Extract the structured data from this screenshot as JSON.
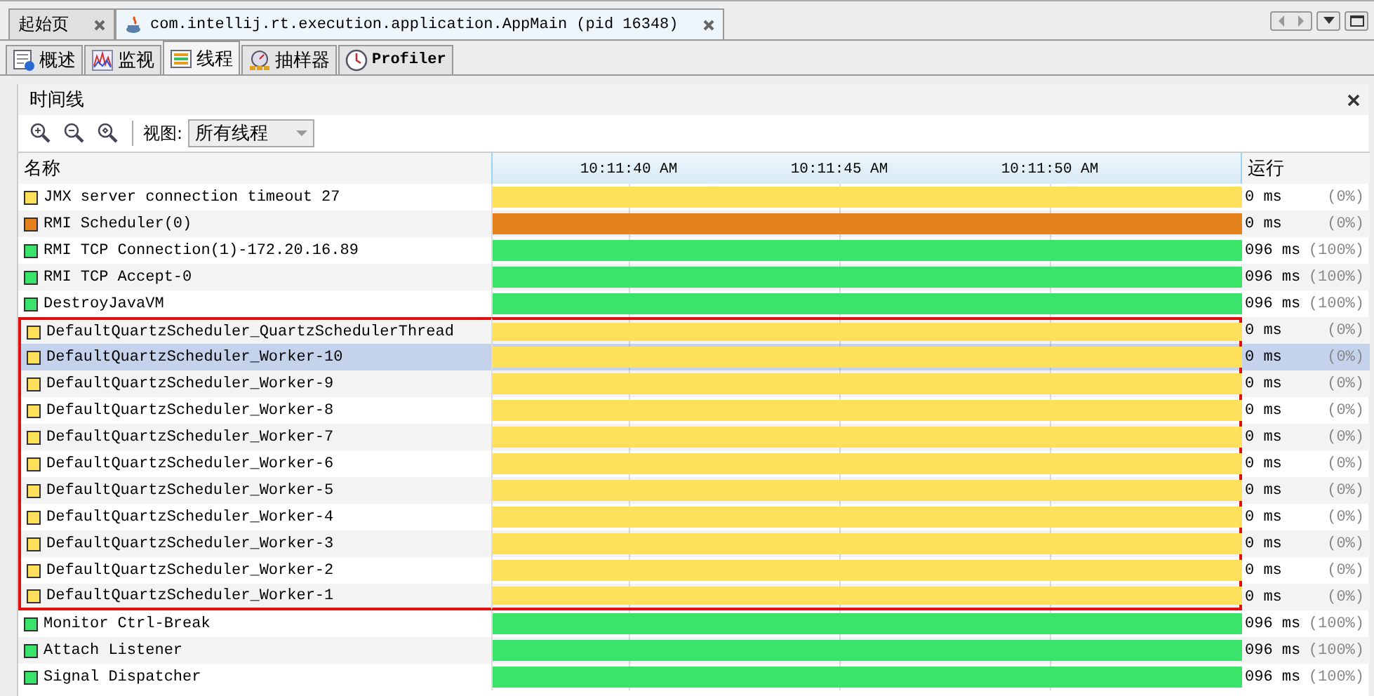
{
  "editor_tabs": [
    {
      "label": "起始页",
      "selected": false,
      "closable": true,
      "kind": "start"
    },
    {
      "label": "com.intellij.rt.execution.application.AppMain (pid 16348)",
      "selected": true,
      "closable": true,
      "kind": "java"
    }
  ],
  "view_tabs": [
    {
      "label": "概述",
      "selected": false,
      "kind": "overview"
    },
    {
      "label": "监视",
      "selected": false,
      "kind": "monitor"
    },
    {
      "label": "线程",
      "selected": true,
      "kind": "threads"
    },
    {
      "label": "抽样器",
      "selected": false,
      "kind": "sampler"
    },
    {
      "label": "Profiler",
      "selected": false,
      "kind": "profiler"
    }
  ],
  "panel": {
    "title": "时间线",
    "view_label": "视图:",
    "view_value": "所有线程"
  },
  "table": {
    "columns": [
      "名称",
      "运行"
    ],
    "time_ticks": [
      "10:11:40 AM",
      "10:11:45 AM",
      "10:11:50 AM"
    ],
    "rows": [
      {
        "name": "JMX server connection timeout 27",
        "color": "#ffe05a",
        "run": "0 ms",
        "percent": "(0%)",
        "selected": false,
        "highlighted": false
      },
      {
        "name": "RMI Scheduler(0)",
        "color": "#e6821e",
        "run": "0 ms",
        "percent": "(0%)",
        "selected": false,
        "highlighted": false
      },
      {
        "name": "RMI TCP Connection(1)-172.20.16.89",
        "color": "#3ae46a",
        "run": "096 ms",
        "percent": "(100%)",
        "selected": false,
        "highlighted": false
      },
      {
        "name": "RMI TCP Accept-0",
        "color": "#3ae46a",
        "run": "096 ms",
        "percent": "(100%)",
        "selected": false,
        "highlighted": false
      },
      {
        "name": "DestroyJavaVM",
        "color": "#3ae46a",
        "run": "096 ms",
        "percent": "(100%)",
        "selected": false,
        "highlighted": false
      },
      {
        "name": "DefaultQuartzScheduler_QuartzSchedulerThread",
        "color": "#ffe05a",
        "run": "0 ms",
        "percent": "(0%)",
        "selected": false,
        "highlighted": true
      },
      {
        "name": "DefaultQuartzScheduler_Worker-10",
        "color": "#ffe05a",
        "run": "0 ms",
        "percent": "(0%)",
        "selected": true,
        "highlighted": true
      },
      {
        "name": "DefaultQuartzScheduler_Worker-9",
        "color": "#ffe05a",
        "run": "0 ms",
        "percent": "(0%)",
        "selected": false,
        "highlighted": true
      },
      {
        "name": "DefaultQuartzScheduler_Worker-8",
        "color": "#ffe05a",
        "run": "0 ms",
        "percent": "(0%)",
        "selected": false,
        "highlighted": true
      },
      {
        "name": "DefaultQuartzScheduler_Worker-7",
        "color": "#ffe05a",
        "run": "0 ms",
        "percent": "(0%)",
        "selected": false,
        "highlighted": true
      },
      {
        "name": "DefaultQuartzScheduler_Worker-6",
        "color": "#ffe05a",
        "run": "0 ms",
        "percent": "(0%)",
        "selected": false,
        "highlighted": true
      },
      {
        "name": "DefaultQuartzScheduler_Worker-5",
        "color": "#ffe05a",
        "run": "0 ms",
        "percent": "(0%)",
        "selected": false,
        "highlighted": true
      },
      {
        "name": "DefaultQuartzScheduler_Worker-4",
        "color": "#ffe05a",
        "run": "0 ms",
        "percent": "(0%)",
        "selected": false,
        "highlighted": true
      },
      {
        "name": "DefaultQuartzScheduler_Worker-3",
        "color": "#ffe05a",
        "run": "0 ms",
        "percent": "(0%)",
        "selected": false,
        "highlighted": true
      },
      {
        "name": "DefaultQuartzScheduler_Worker-2",
        "color": "#ffe05a",
        "run": "0 ms",
        "percent": "(0%)",
        "selected": false,
        "highlighted": true
      },
      {
        "name": "DefaultQuartzScheduler_Worker-1",
        "color": "#ffe05a",
        "run": "0 ms",
        "percent": "(0%)",
        "selected": false,
        "highlighted": true
      },
      {
        "name": "Monitor Ctrl-Break",
        "color": "#3ae46a",
        "run": "096 ms",
        "percent": "(100%)",
        "selected": false,
        "highlighted": false
      },
      {
        "name": "Attach Listener",
        "color": "#3ae46a",
        "run": "096 ms",
        "percent": "(100%)",
        "selected": false,
        "highlighted": false
      },
      {
        "name": "Signal Dispatcher",
        "color": "#3ae46a",
        "run": "096 ms",
        "percent": "(100%)",
        "selected": false,
        "highlighted": false
      }
    ]
  }
}
